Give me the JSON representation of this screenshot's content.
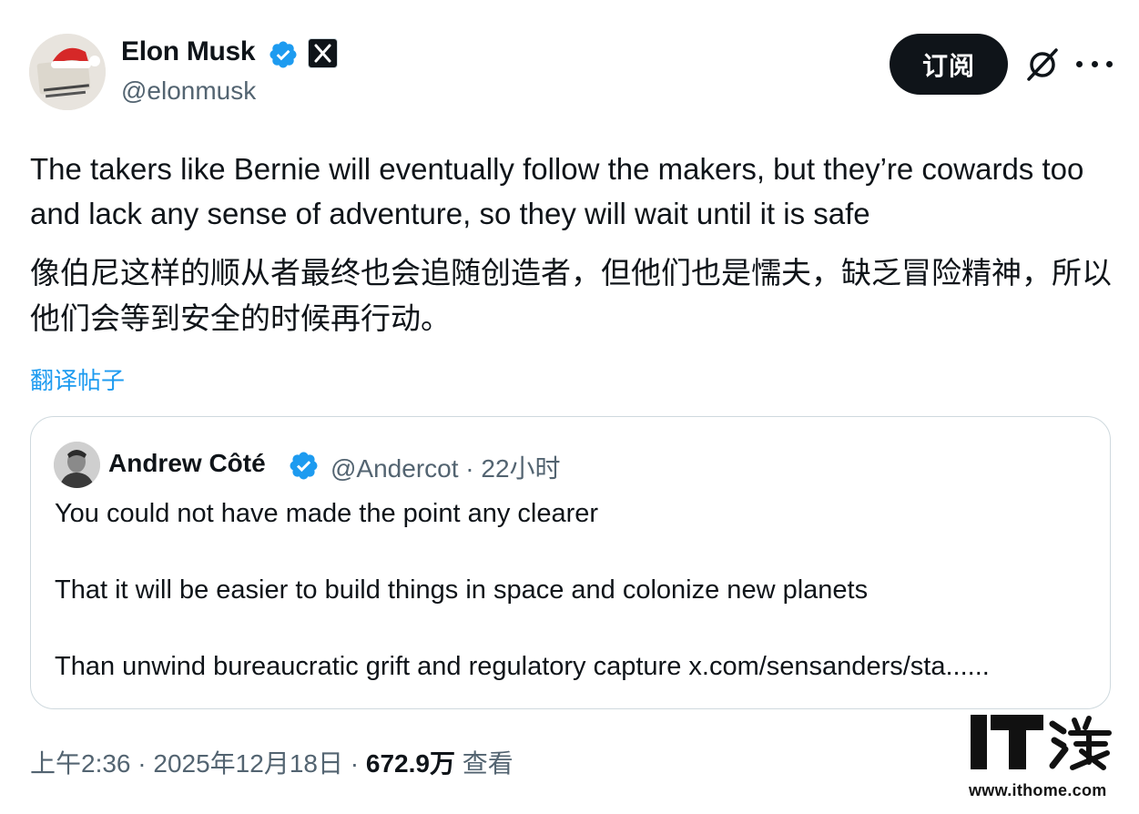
{
  "author": {
    "name": "Elon Musk",
    "handle": "@elonmusk",
    "avatar": "avatar-with-santa-hat",
    "verified_icon": "verified-badge-icon",
    "affiliate_icon": "x-logo-icon"
  },
  "header": {
    "subscribe_label": "订阅",
    "grok_icon": "grok-icon",
    "more_icon": "more-icon"
  },
  "tweet": {
    "text_en": "The takers like Bernie will eventually follow the makers, but they’re cowards too and lack any sense of adventure, so they will wait until it is safe",
    "text_zh": "像伯尼这样的顺从者最终也会追随创造者，但他们也是懦夫，缺乏冒险精神，所以他们会等到安全的时候再行动。",
    "translate_label": "翻译帖子"
  },
  "quote": {
    "name": "Andrew Côté",
    "handle": "@Andercot",
    "separator": "·",
    "time": "22小时",
    "lines": [
      "You could not have made the point any clearer",
      "That it will be easier to build things in space and colonize new planets",
      "Than unwind bureaucratic grift and regulatory capture x.com/sensanders/sta......"
    ]
  },
  "footer": {
    "time": "上午2:36",
    "date": "2025年12月18日",
    "separator": "·",
    "views": "672.9万",
    "views_label": "查看"
  },
  "watermark": {
    "logo": "IT之家",
    "url": "www.ithome.com"
  },
  "colors": {
    "text": "#0f1419",
    "secondary": "#536471",
    "link": "#1d9bf0",
    "verified": "#1d9bf0",
    "border": "#cfd9de"
  }
}
